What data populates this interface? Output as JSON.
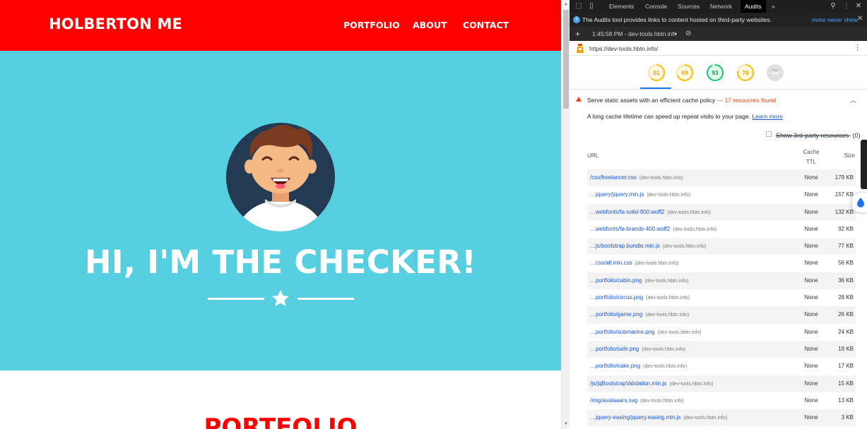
{
  "site": {
    "brand": "HOLBERTON ME",
    "nav": [
      "PORTFOLIO",
      "ABOUT",
      "CONTACT"
    ],
    "hero_title": "HI, I'M THE CHECKER!",
    "section_heading": "PORTFOLIO",
    "colors": {
      "nav_bg": "#ff0000",
      "hero_bg": "#56cfe1",
      "accent": "#ff0000"
    }
  },
  "devtools": {
    "tabs": [
      "Elements",
      "Console",
      "Sources",
      "Network",
      "Audits"
    ],
    "active_tab": "Audits",
    "more_tabs_icon": "»",
    "info_text": "The Audits tool provides links to content hosted on third-party websites.",
    "info_more": "more never show",
    "report_label": "1:45:58 PM - dev-tools.hbtn.inf▾",
    "audited_url": "https://dev-tools.hbtn.info/",
    "gauges": [
      {
        "score": "61",
        "color": "#fbbc04"
      },
      {
        "score": "69",
        "color": "#fbbc04"
      },
      {
        "score": "93",
        "color": "#0cce6b"
      },
      {
        "score": "78",
        "color": "#fbbc04"
      },
      {
        "score": "PWA",
        "color": "#bdbdbd"
      }
    ],
    "audit": {
      "title": "Serve static assets with an efficient cache policy",
      "dash": "—",
      "count": "17 resources found",
      "description": "A long cache lifetime can speed up repeat visits to your page.",
      "learn_more": "Learn more",
      "third_party_label": "Show 3rd-party resources",
      "third_party_count": "(0)"
    },
    "table": {
      "headers": {
        "url": "URL",
        "ttl_line1": "Cache",
        "ttl_line2": "TTL",
        "size": "Size"
      },
      "rows": [
        {
          "url": "/css/freelancer.css",
          "host": "(dev-tools.hbtn.info)",
          "ttl": "None",
          "size": "179 KB"
        },
        {
          "url": "…jquery/jquery.min.js",
          "host": "(dev-tools.hbtn.info)",
          "ttl": "None",
          "size": "157 KB"
        },
        {
          "url": "…webfonts/fa-solid-900.woff2",
          "host": "(dev-tools.hbtn.info)",
          "ttl": "None",
          "size": "132 KB"
        },
        {
          "url": "…webfonts/fa-brands-400.woff2",
          "host": "(dev-tools.hbtn.info)",
          "ttl": "None",
          "size": "92 KB"
        },
        {
          "url": "…js/bootstrap.bundle.min.js",
          "host": "(dev-tools.hbtn.info)",
          "ttl": "None",
          "size": "77 KB"
        },
        {
          "url": "…css/all.min.css",
          "host": "(dev-tools.hbtn.info)",
          "ttl": "None",
          "size": "56 KB"
        },
        {
          "url": "…portfolio/cabin.png",
          "host": "(dev-tools.hbtn.info)",
          "ttl": "None",
          "size": "36 KB"
        },
        {
          "url": "…portfolio/circus.png",
          "host": "(dev-tools.hbtn.info)",
          "ttl": "None",
          "size": "28 KB"
        },
        {
          "url": "…portfolio/game.png",
          "host": "(dev-tools.hbtn.info)",
          "ttl": "None",
          "size": "26 KB"
        },
        {
          "url": "…portfolio/submarine.png",
          "host": "(dev-tools.hbtn.info)",
          "ttl": "None",
          "size": "24 KB"
        },
        {
          "url": "…portfolio/safe.png",
          "host": "(dev-tools.hbtn.info)",
          "ttl": "None",
          "size": "19 KB"
        },
        {
          "url": "…portfolio/cake.png",
          "host": "(dev-tools.hbtn.info)",
          "ttl": "None",
          "size": "17 KB"
        },
        {
          "url": "/js/jqBootstrapValidation.min.js",
          "host": "(dev-tools.hbtn.info)",
          "ttl": "None",
          "size": "15 KB"
        },
        {
          "url": "/img/avataaars.svg",
          "host": "(dev-tools.hbtn.info)",
          "ttl": "None",
          "size": "13 KB"
        },
        {
          "url": "…jquery-easing/jquery.easing.min.js",
          "host": "(dev-tools.hbtn.info)",
          "ttl": "None",
          "size": "3 KB"
        }
      ]
    }
  }
}
